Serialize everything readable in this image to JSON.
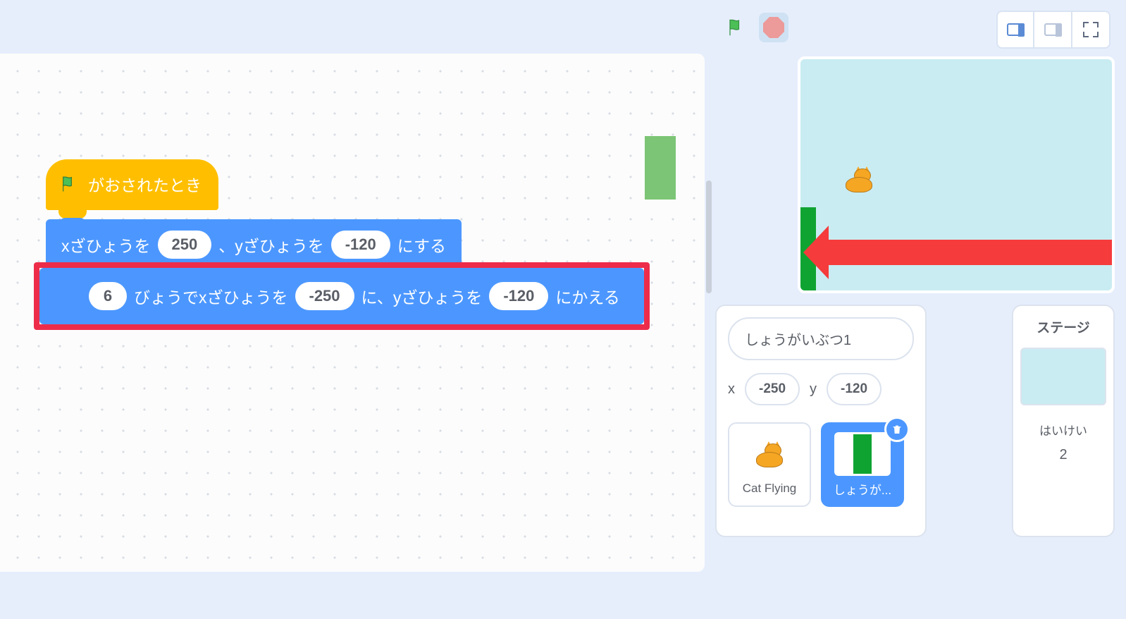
{
  "controls": {
    "green_flag": "green-flag",
    "stop": "stop"
  },
  "blocks": {
    "hat_label": "がおされたとき",
    "goto": {
      "part1": "xざひょうを",
      "x": "250",
      "part2": "、yざひょうを",
      "y": "-120",
      "part3": "にする"
    },
    "glide": {
      "secs": "6",
      "part1": "びょうでxざひょうを",
      "x": "-250",
      "part2": "に、yざひょうを",
      "y": "-120",
      "part3": "にかえる"
    }
  },
  "sprite_pane": {
    "name": "しょうがいぶつ1",
    "x_label": "x",
    "x_value": "-250",
    "y_label": "y",
    "y_value": "-120",
    "sprites": [
      {
        "label": "Cat Flying"
      },
      {
        "label": "しょうが..."
      }
    ]
  },
  "stage_pane": {
    "title": "ステージ",
    "backdrop_label": "はいけい",
    "backdrop_count": "2"
  }
}
